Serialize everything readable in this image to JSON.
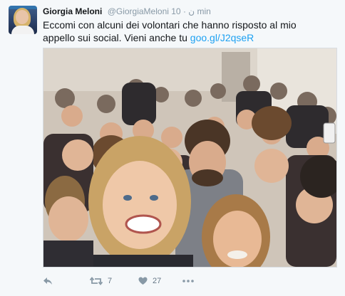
{
  "tweet": {
    "author_name": "Giorgia Meloni",
    "handle": "@GiorgiaMeloni",
    "rtl_glyph": "ن",
    "separator": "·",
    "time": "10 min",
    "text": "Eccomi con alcuni dei volontari che hanno risposto al mio appello sui social. Vieni anche tu",
    "link": "goo.gl/J2qseR",
    "photo_alt": "Group selfie with volunteers",
    "actions": {
      "reply_icon": "reply-icon",
      "retweet_icon": "retweet-icon",
      "retweet_count": "7",
      "like_icon": "heart-icon",
      "like_count": "27",
      "more_icon": "more-icon"
    }
  },
  "colors": {
    "link": "#1da1f2",
    "text": "#14171a",
    "secondary": "#8899a6",
    "background": "#f5f8fa"
  }
}
